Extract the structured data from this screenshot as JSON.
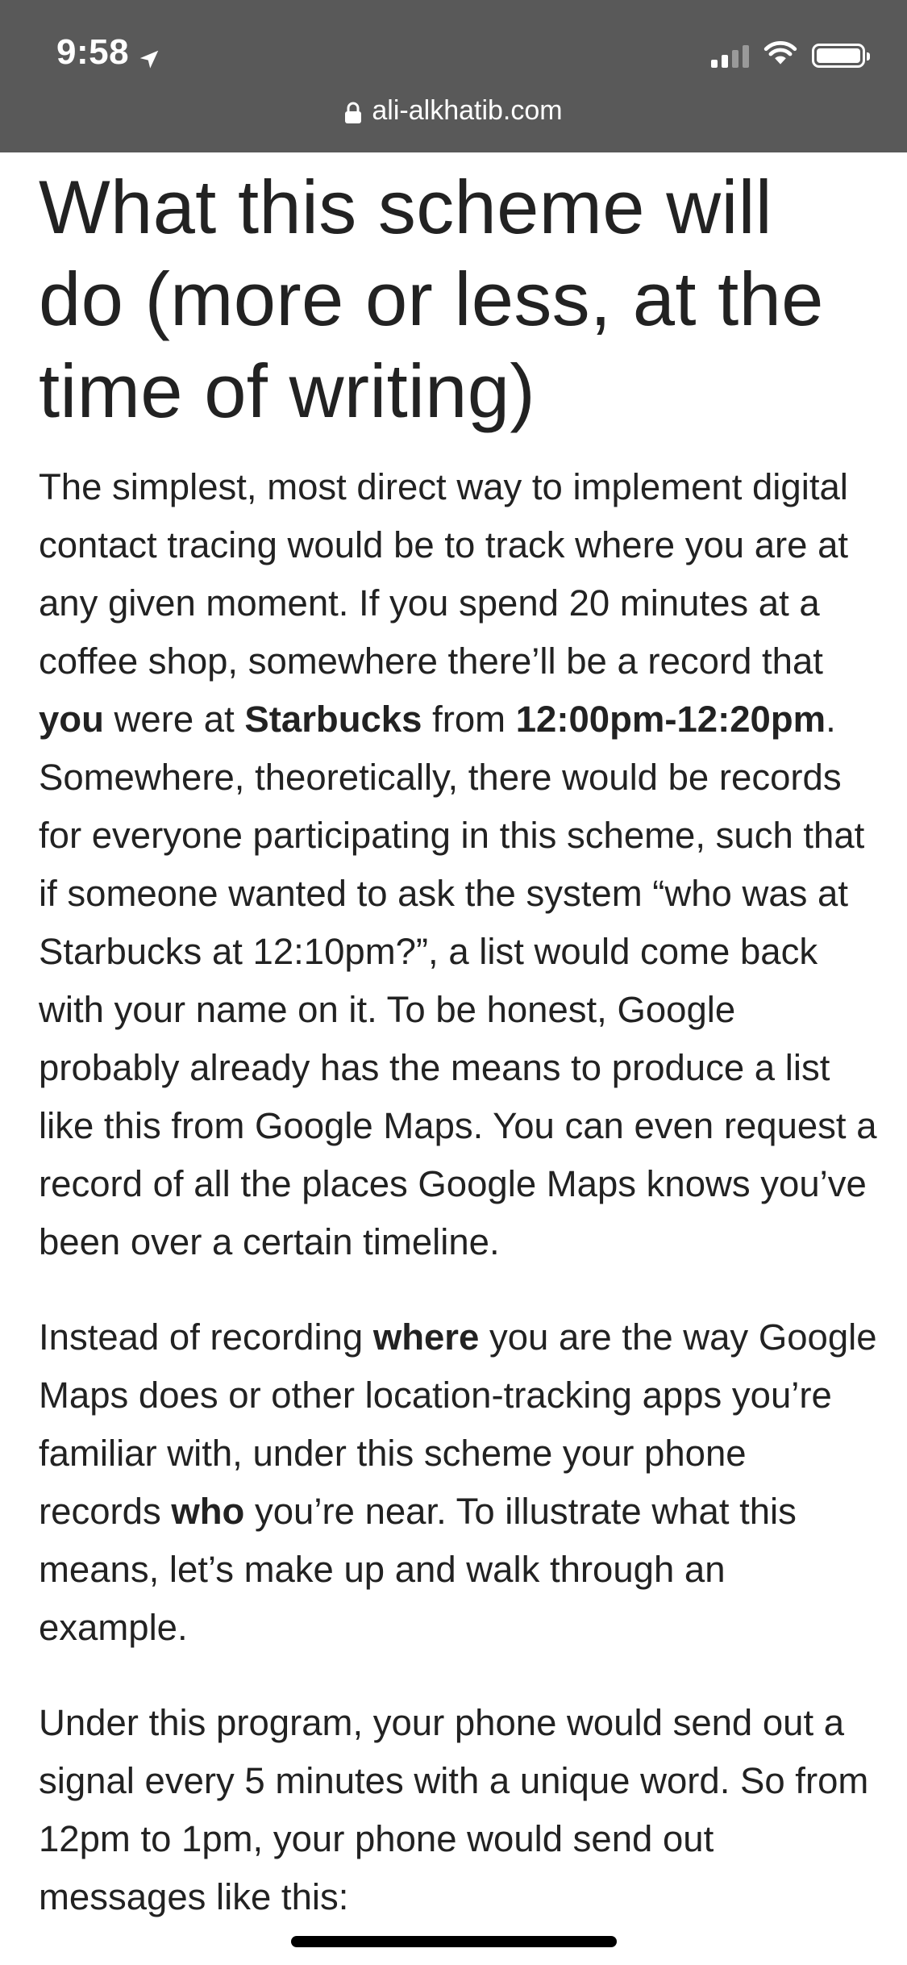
{
  "status_bar": {
    "time": "9:58",
    "location_icon": "location-arrow-icon",
    "signal_icon": "cellular-signal-icon",
    "wifi_icon": "wifi-icon",
    "battery_icon": "battery-icon"
  },
  "url_bar": {
    "domain": "ali-alkhatib.com",
    "lock_icon": "lock-icon"
  },
  "article": {
    "heading": "What this scheme will do (more or less, at the time of writing)",
    "p1": {
      "t1": "The simplest, most direct way to implement digital contact tracing would be to track where you are at any given moment. If you spend 20 minutes at a coffee shop, somewhere there’ll be a record that ",
      "b1": "you",
      "t2": " were at ",
      "b2": "Starbucks",
      "t3": " from ",
      "b3": "12:00pm-12:20pm",
      "t4": ". Somewhere, theoretically, there would be records for everyone participating in this scheme, such that if someone wanted to ask the system “who was at Starbucks at 12:10pm?”, a list would come back with your name on it. To be honest, Google probably already has the means to produce a list like this from Google Maps. You can even request a record of all the places Google Maps knows you’ve been over a certain timeline."
    },
    "p2": {
      "t1": "Instead of recording ",
      "b1": "where",
      "t2": " you are the way Google Maps does or other location-tracking apps you’re familiar with, under this scheme your phone records ",
      "b2": "who",
      "t3": " you’re near. To illustrate what this means, let’s make up and walk through an example."
    },
    "p3": {
      "t1": "Under this program, your phone would send out a signal every 5 minutes with a unique word. So from 12pm to 1pm, your phone would send out messages like this:"
    }
  },
  "colors": {
    "chrome_bg": "#595959",
    "text": "#222222",
    "page_bg": "#ffffff"
  }
}
